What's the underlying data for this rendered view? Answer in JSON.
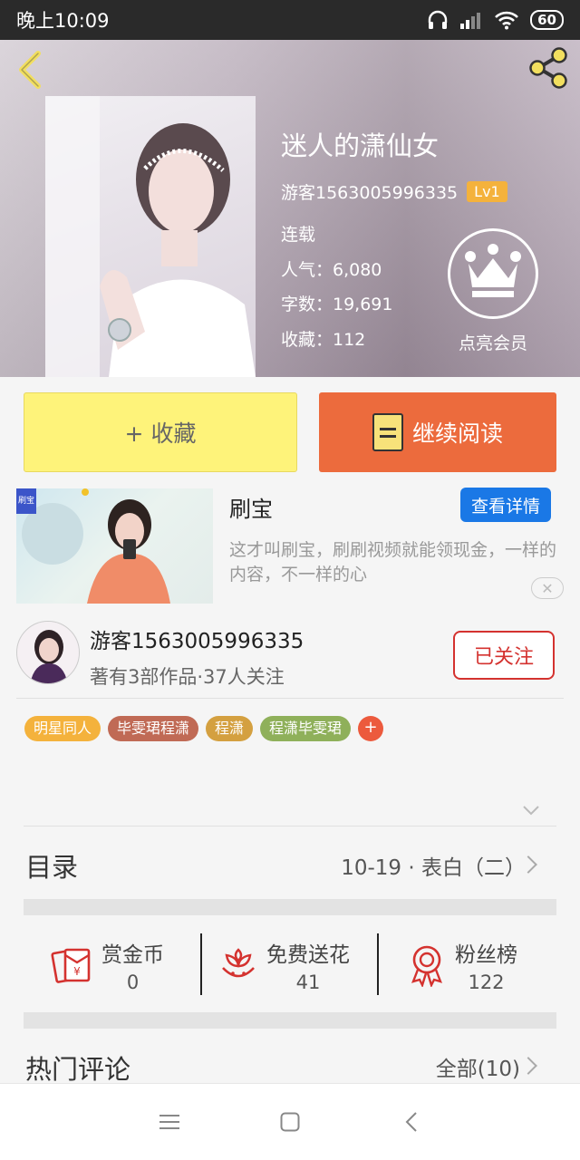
{
  "status_bar": {
    "time": "晚上10:09",
    "battery": "60"
  },
  "book": {
    "title": "迷人的潇仙女",
    "author_id": "游客1563005996335",
    "level": "Lv1",
    "status": "连载",
    "popularity": "人气：6,080",
    "word_count": "字数：19,691",
    "favorites": "收藏：112"
  },
  "vip": {
    "label": "点亮会员"
  },
  "actions": {
    "collect": "+ 收藏",
    "continue_read": "继续阅读"
  },
  "ad": {
    "title": "刷宝",
    "detail_button": "查看详情",
    "description": "这才叫刷宝，刷刷视频就能领现金，一样的内容，不一样的心",
    "close": "✕"
  },
  "author": {
    "name": "游客1563005996335",
    "stats": "著有3部作品·37人关注",
    "follow_button": "已关注"
  },
  "tags": [
    {
      "label": "明星同人",
      "color": "#f4b23c"
    },
    {
      "label": "毕雯珺程潇",
      "color": "#c06a55"
    },
    {
      "label": "程潇",
      "color": "#d4a040"
    },
    {
      "label": "程潇毕雯珺",
      "color": "#8fb05a"
    }
  ],
  "tag_add": "+",
  "catalog": {
    "label": "目录",
    "latest": "10-19 · 表白（二）"
  },
  "stats": [
    {
      "label": "赏金币",
      "value": "0",
      "icon": "red-envelope-icon"
    },
    {
      "label": "免费送花",
      "value": "41",
      "icon": "flower-icon"
    },
    {
      "label": "粉丝榜",
      "value": "122",
      "icon": "medal-icon"
    }
  ],
  "comments": {
    "label": "热门评论",
    "all": "全部(10)"
  },
  "colors": {
    "accent_orange": "#ec6b3d",
    "accent_yellow": "#fef37a",
    "follow_red": "#d4322f",
    "ad_blue": "#1a78e6"
  }
}
